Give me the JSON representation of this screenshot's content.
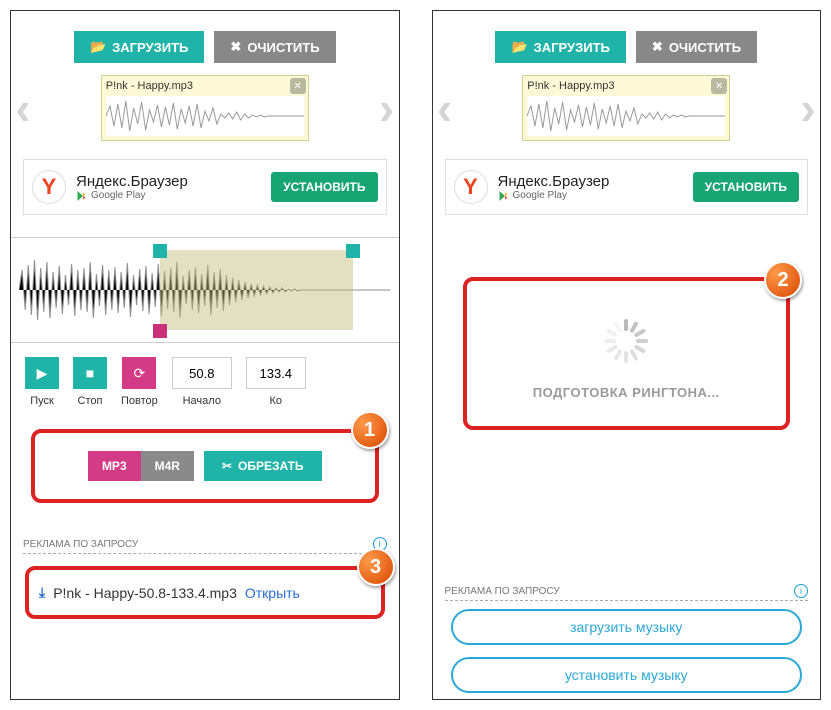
{
  "colors": {
    "teal": "#1fb4a7",
    "gray": "#888",
    "pink": "#d43b86",
    "red": "#d22"
  },
  "top": {
    "load": "ЗАГРУЗИТЬ",
    "clear": "ОЧИСТИТЬ"
  },
  "file": {
    "name": "P!nk - Happy.mp3"
  },
  "ad": {
    "title": "Яндекс.Браузер",
    "store": "Google Play",
    "install": "УСТАНОВИТЬ"
  },
  "controls": {
    "play": "Пуск",
    "stop": "Стоп",
    "repeat": "Повтор",
    "start": "Начало",
    "end": "Ко",
    "start_val": "50.8",
    "end_val": "133.4"
  },
  "cut": {
    "mp3": "MP3",
    "m4r": "M4R",
    "cut": "ОБРЕЗАТЬ"
  },
  "adreq": "РЕКЛАМА ПО ЗАПРОСУ",
  "download": {
    "file": "P!nk - Happy-50.8-133.4.mp3",
    "open": "Открыть"
  },
  "loading": "ПОДГОТОВКА РИНГТОНА...",
  "links": {
    "load_music": "загрузить музыку",
    "set_music": "установить музыку"
  },
  "callouts": {
    "c1": "1",
    "c2": "2",
    "c3": "3"
  }
}
